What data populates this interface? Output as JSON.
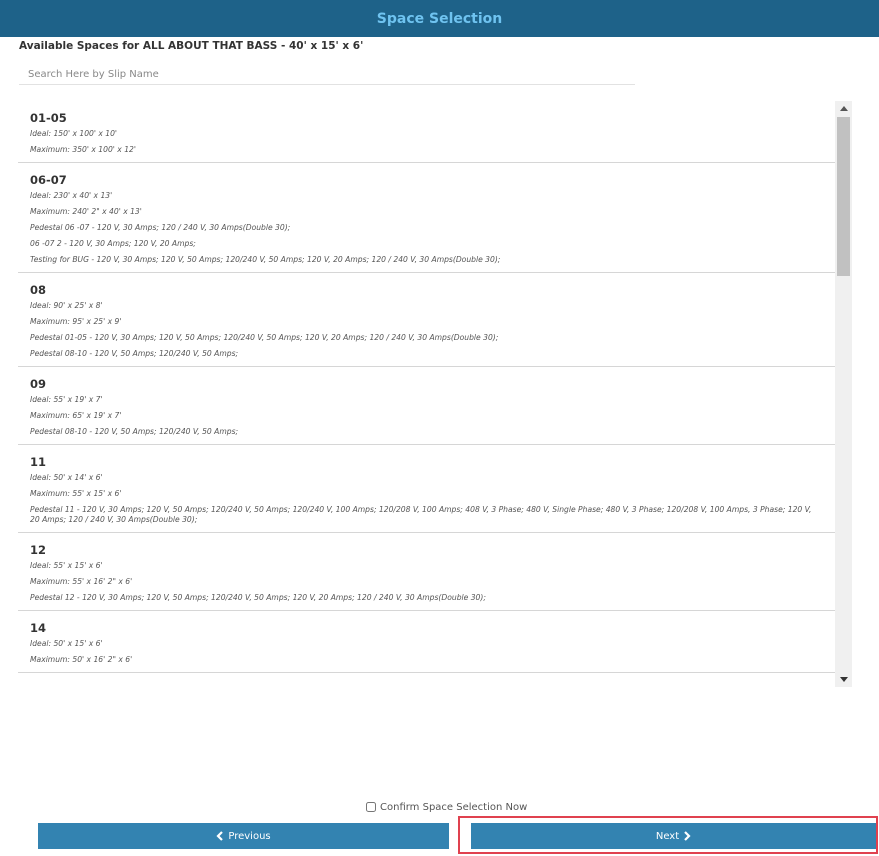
{
  "header": {
    "title": "Space Selection"
  },
  "subtitle": "Available Spaces for ALL ABOUT THAT BASS - 40' x 15' x 6'",
  "search": {
    "placeholder": "Search Here by Slip Name",
    "value": ""
  },
  "slips": [
    {
      "name": "01-05",
      "lines": [
        "Ideal: 150' x 100' x 10'",
        "Maximum: 350' x 100' x 12'"
      ]
    },
    {
      "name": "06-07",
      "lines": [
        "Ideal: 230' x 40' x 13'",
        "Maximum: 240' 2\" x 40' x 13'",
        "Pedestal 06 -07 - 120 V, 30 Amps; 120 / 240 V, 30 Amps(Double 30);",
        "06 -07 2 - 120 V, 30 Amps; 120 V, 20 Amps;",
        "Testing for BUG - 120 V, 30 Amps; 120 V, 50 Amps; 120/240 V, 50 Amps; 120 V, 20 Amps; 120 / 240 V, 30 Amps(Double 30);"
      ]
    },
    {
      "name": "08",
      "lines": [
        "Ideal: 90' x 25' x 8'",
        "Maximum: 95' x 25' x 9'",
        "Pedestal 01-05 - 120 V, 30 Amps; 120 V, 50 Amps; 120/240 V, 50 Amps; 120 V, 20 Amps; 120 / 240 V, 30 Amps(Double 30);",
        "Pedestal 08-10 - 120 V, 50 Amps; 120/240 V, 50 Amps;"
      ]
    },
    {
      "name": "09",
      "lines": [
        "Ideal: 55' x 19' x 7'",
        "Maximum: 65' x 19' x 7'",
        "Pedestal 08-10 - 120 V, 50 Amps; 120/240 V, 50 Amps;"
      ]
    },
    {
      "name": "11",
      "lines": [
        "Ideal: 50' x 14' x 6'",
        "Maximum: 55' x 15' x 6'",
        "Pedestal 11 - 120 V, 30 Amps; 120 V, 50 Amps; 120/240 V, 50 Amps; 120/240 V, 100 Amps; 120/208 V, 100 Amps; 408 V, 3 Phase; 480 V, Single Phase; 480 V, 3 Phase; 120/208 V, 100 Amps, 3 Phase; 120 V, 20 Amps; 120 / 240 V, 30 Amps(Double 30);"
      ]
    },
    {
      "name": "12",
      "lines": [
        "Ideal: 55' x 15' x 6'",
        "Maximum: 55' x 16' 2\" x 6'",
        "Pedestal 12 - 120 V, 30 Amps; 120 V, 50 Amps; 120/240 V, 50 Amps; 120 V, 20 Amps; 120 / 240 V, 30 Amps(Double 30);"
      ]
    },
    {
      "name": "14",
      "lines": [
        "Ideal: 50' x 15' x 6'",
        "Maximum: 50' x 16' 2\" x 6'"
      ]
    }
  ],
  "confirm": {
    "label": "Confirm Space Selection Now",
    "checked": false
  },
  "buttons": {
    "previous": "Previous",
    "next": "Next"
  },
  "colors": {
    "header_bg": "#1e6289",
    "header_text": "#6fc3f0",
    "button_bg": "#3383b1",
    "highlight": "#e0414f"
  }
}
